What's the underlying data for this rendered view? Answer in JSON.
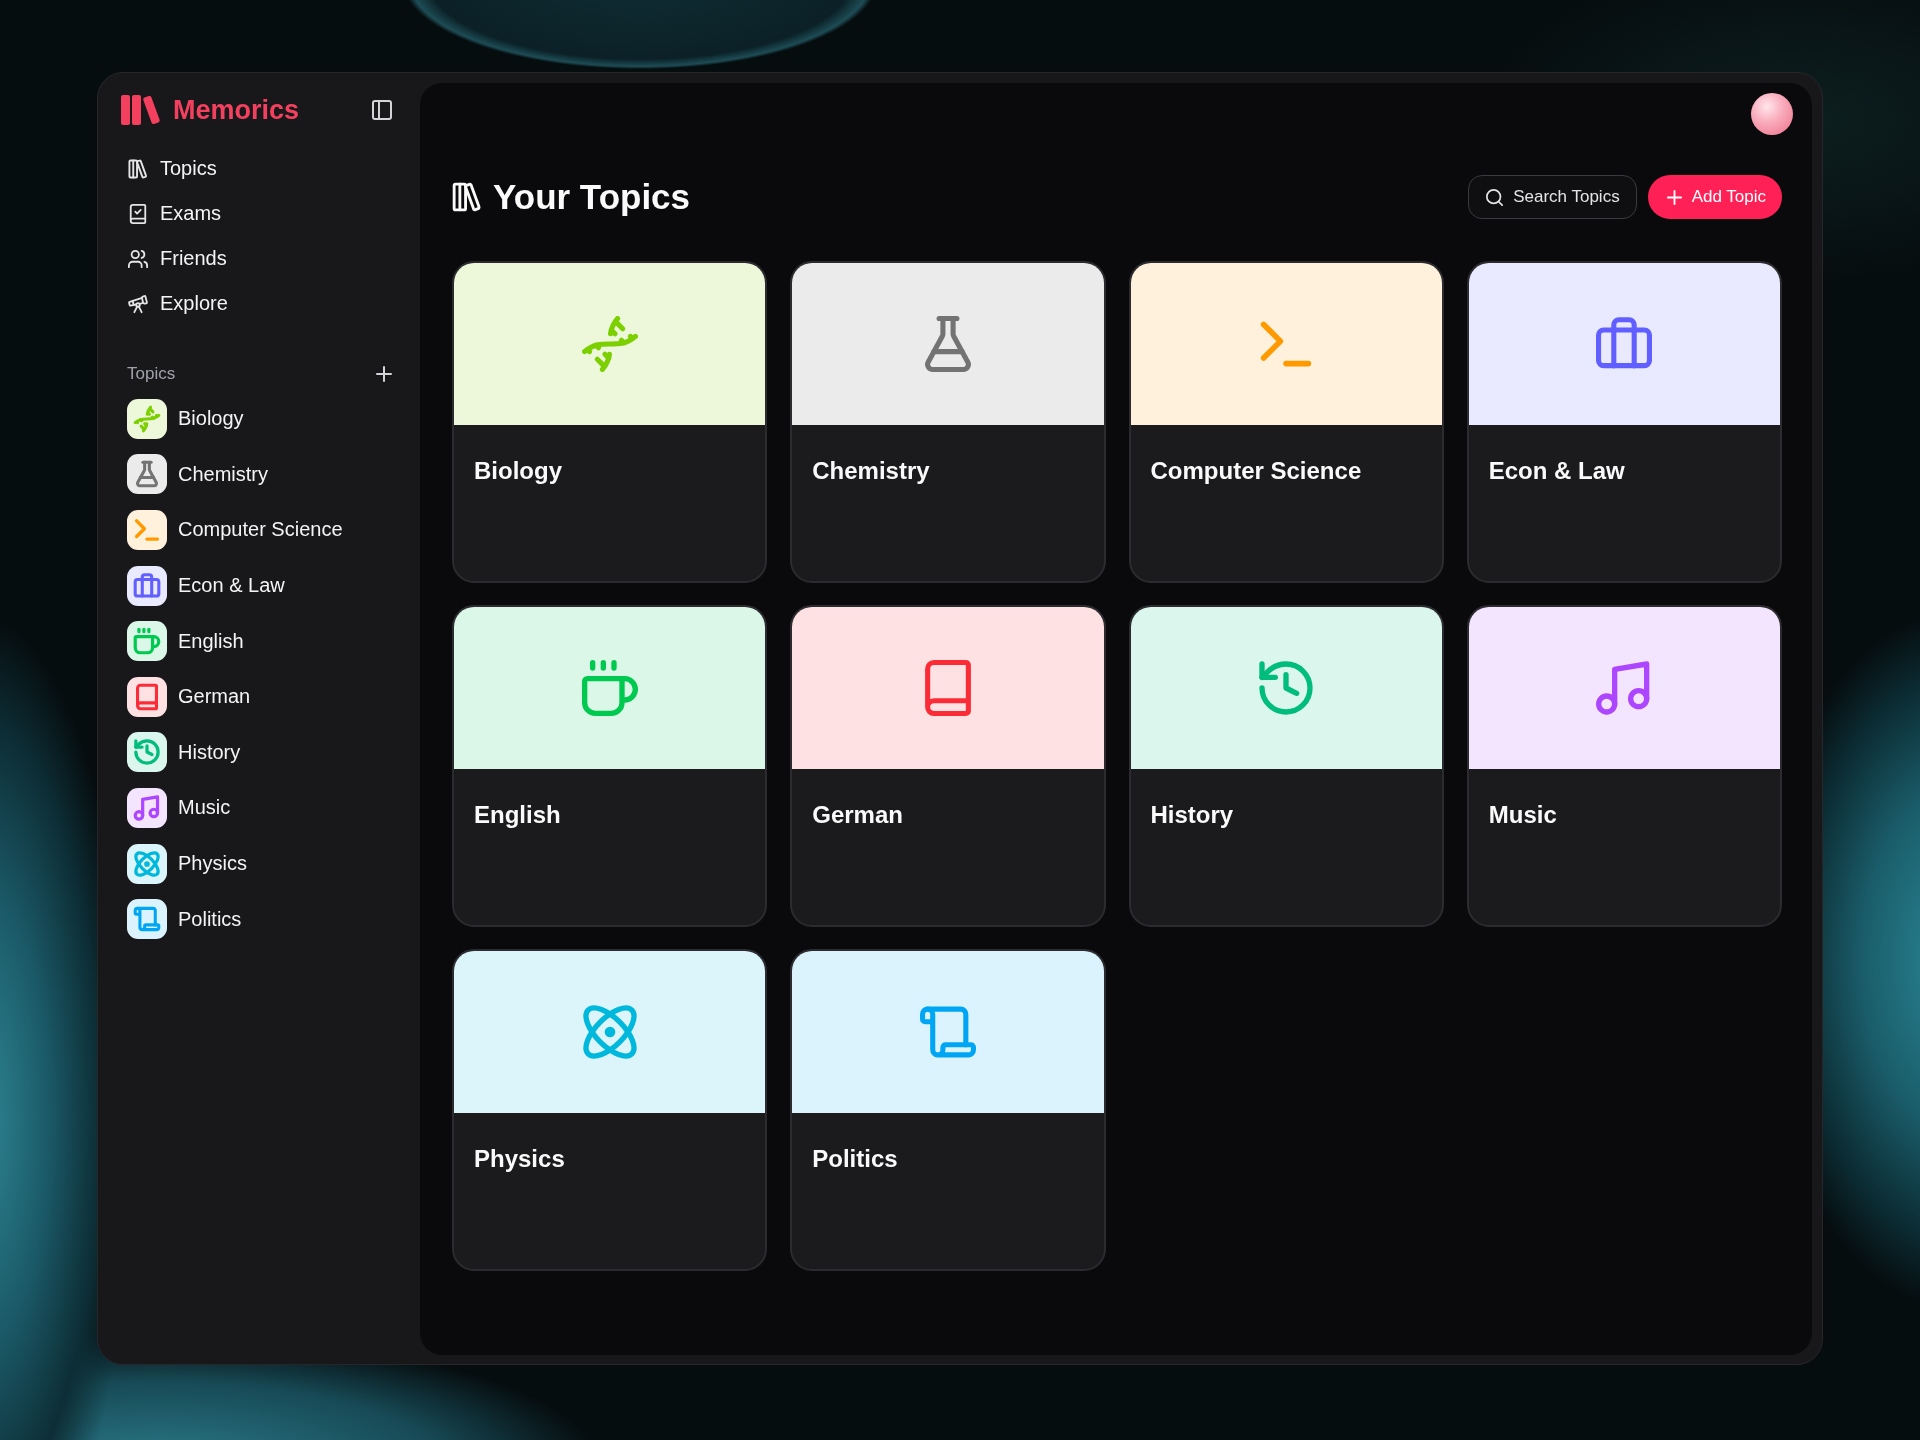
{
  "app": {
    "name": "Memorics"
  },
  "sidebar": {
    "nav": [
      {
        "label": "Topics",
        "kind": "books"
      },
      {
        "label": "Exams",
        "kind": "exam"
      },
      {
        "label": "Friends",
        "kind": "users"
      },
      {
        "label": "Explore",
        "kind": "telescope"
      }
    ],
    "section": {
      "title": "Topics"
    },
    "topics": [
      {
        "label": "Biology",
        "kind": "dna",
        "color": "#7ccf00"
      },
      {
        "label": "Chemistry",
        "kind": "flask",
        "color": "#737373"
      },
      {
        "label": "Computer Science",
        "kind": "terminal",
        "color": "#fe9a00"
      },
      {
        "label": "Econ & Law",
        "kind": "briefcase",
        "color": "#615fff"
      },
      {
        "label": "English",
        "kind": "coffee",
        "color": "#00c950"
      },
      {
        "label": "German",
        "kind": "book",
        "color": "#fb2c36"
      },
      {
        "label": "History",
        "kind": "history",
        "color": "#00bc7d"
      },
      {
        "label": "Music",
        "kind": "music",
        "color": "#ad46ff"
      },
      {
        "label": "Physics",
        "kind": "atom",
        "color": "#00b8db"
      },
      {
        "label": "Politics",
        "kind": "scroll",
        "color": "#00a6f4"
      }
    ]
  },
  "main": {
    "title": "Your Topics",
    "search_button": "Search Topics",
    "add_button": "Add Topic",
    "cards": [
      {
        "label": "Biology",
        "kind": "dna",
        "color": "#7ccf00"
      },
      {
        "label": "Chemistry",
        "kind": "flask",
        "color": "#737373"
      },
      {
        "label": "Computer Science",
        "kind": "terminal",
        "color": "#fe9a00"
      },
      {
        "label": "Econ & Law",
        "kind": "briefcase",
        "color": "#615fff"
      },
      {
        "label": "English",
        "kind": "coffee",
        "color": "#00c950"
      },
      {
        "label": "German",
        "kind": "book",
        "color": "#fb2c36"
      },
      {
        "label": "History",
        "kind": "history",
        "color": "#00bc7d"
      },
      {
        "label": "Music",
        "kind": "music",
        "color": "#ad46ff"
      },
      {
        "label": "Physics",
        "kind": "atom",
        "color": "#00b8db"
      },
      {
        "label": "Politics",
        "kind": "scroll",
        "color": "#00a6f4"
      }
    ]
  }
}
